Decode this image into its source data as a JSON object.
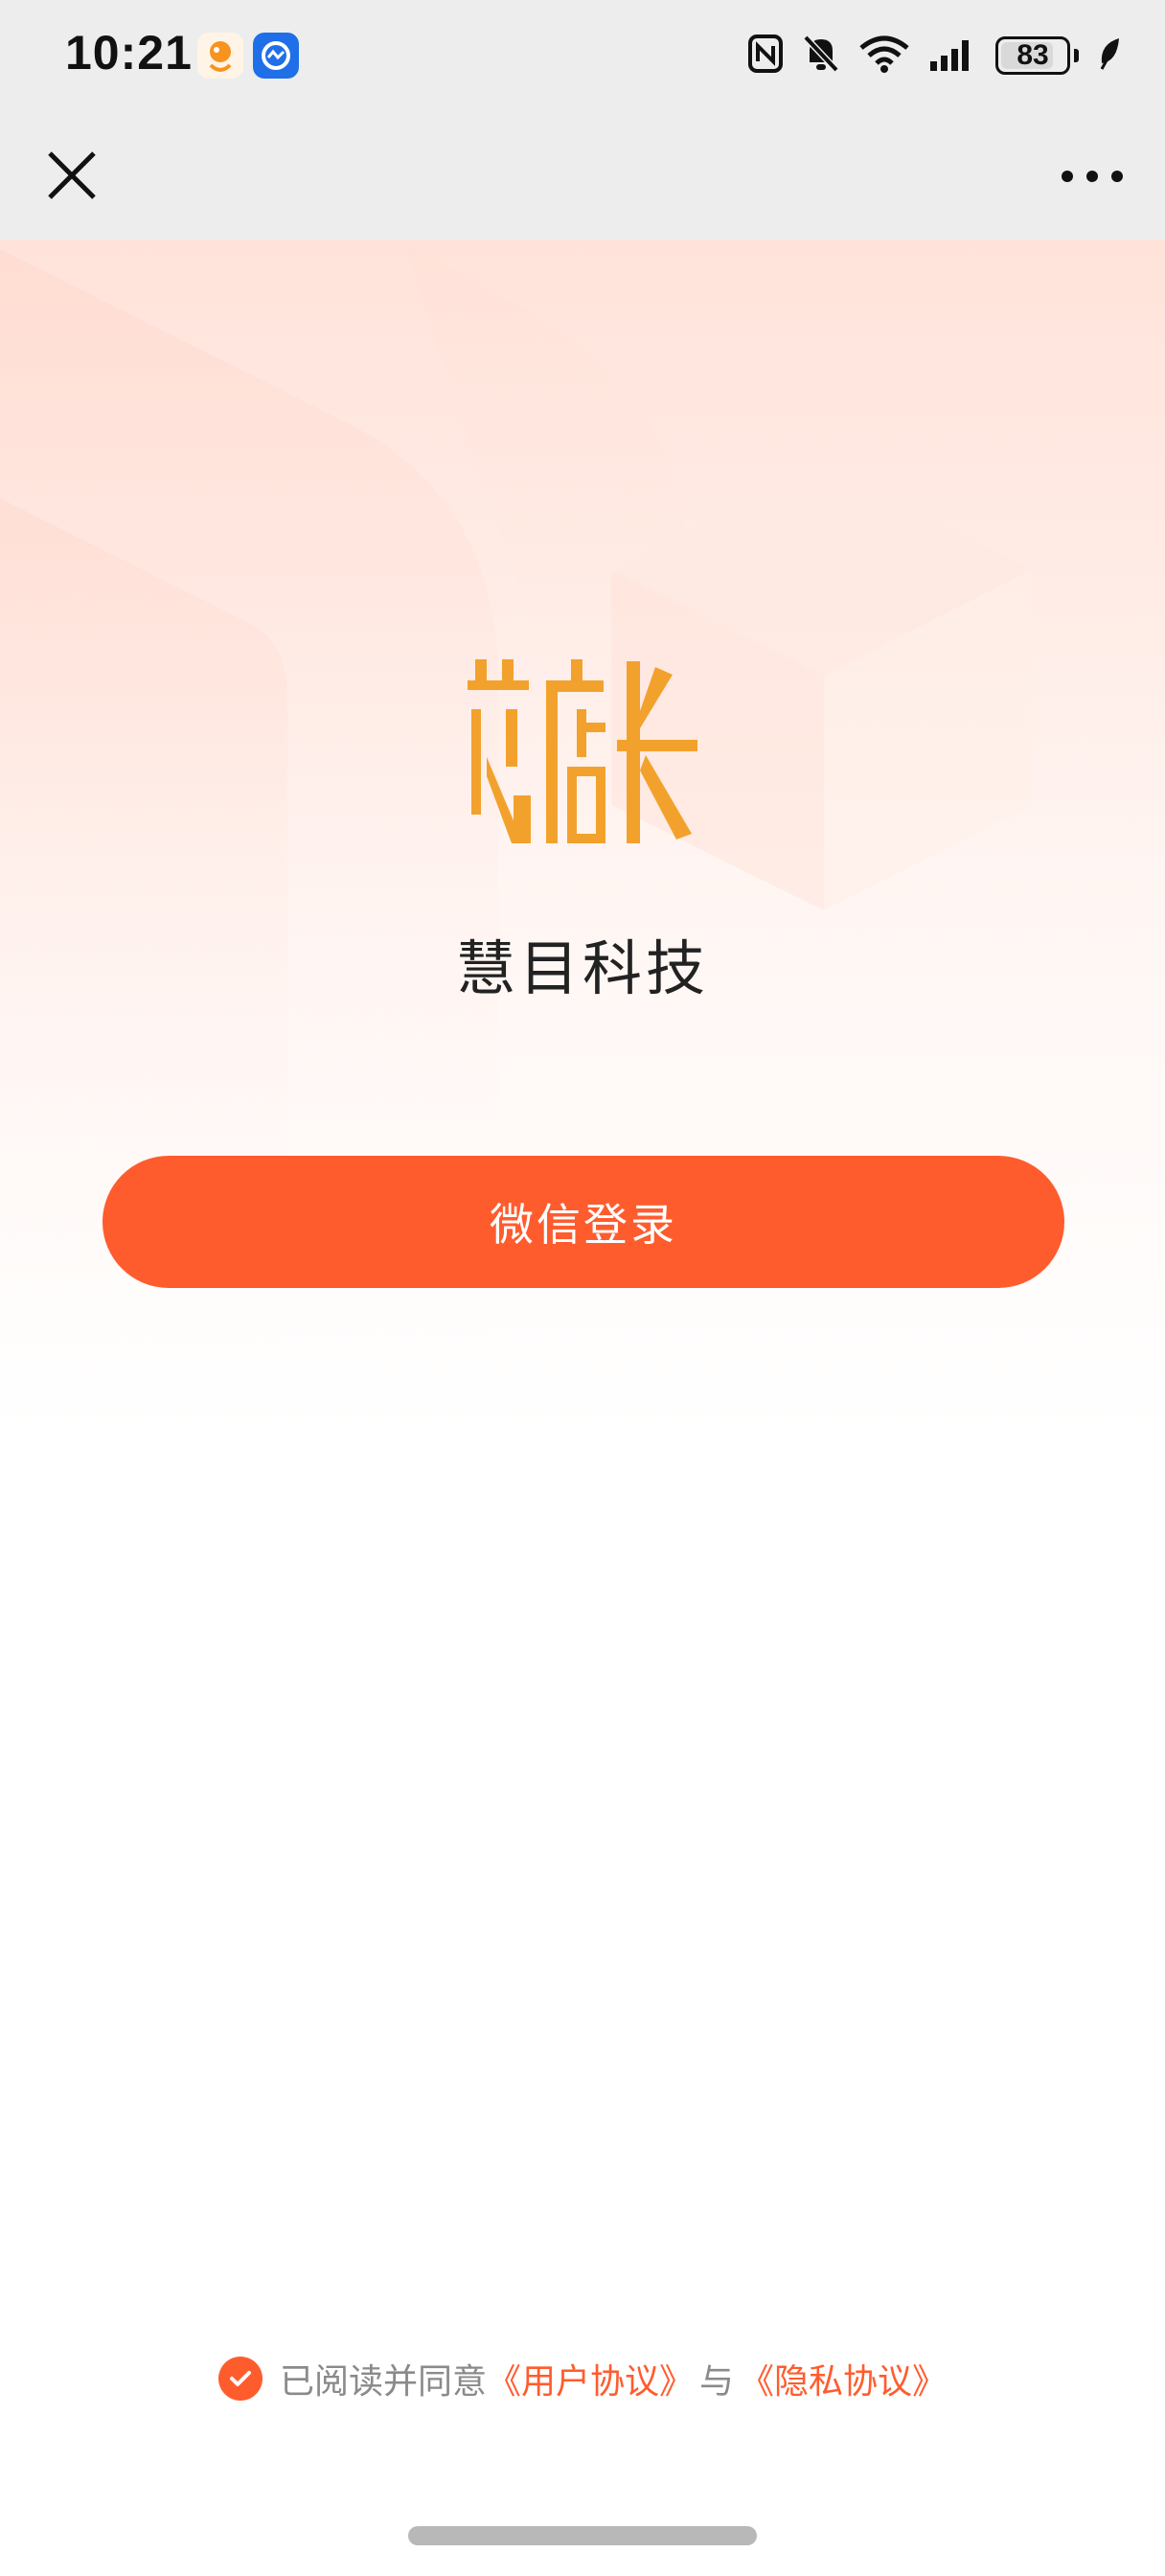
{
  "status_bar": {
    "time": "10:21",
    "battery": "83",
    "battery_level": 0.83,
    "icons": [
      "app-notification-icon",
      "app-notification-icon-2",
      "nfc-icon",
      "mute-bell-icon",
      "wifi-icon",
      "signal-icon",
      "battery-icon",
      "leaf-icon"
    ]
  },
  "nav": {
    "close_icon": "close-icon",
    "more_icon": "more-icon"
  },
  "hero": {
    "logo_text": "芯店长",
    "company_name": "慧目科技"
  },
  "login": {
    "button_label": "微信登录"
  },
  "agreement": {
    "prefix": "已阅读并同意",
    "user_agreement": "《用户协议》",
    "connector": "与",
    "privacy_agreement": "《隐私协议》",
    "checked": true
  },
  "colors": {
    "accent": "#ff5c2e",
    "logo": "#f2a22c",
    "nav_bg": "#ededed"
  }
}
